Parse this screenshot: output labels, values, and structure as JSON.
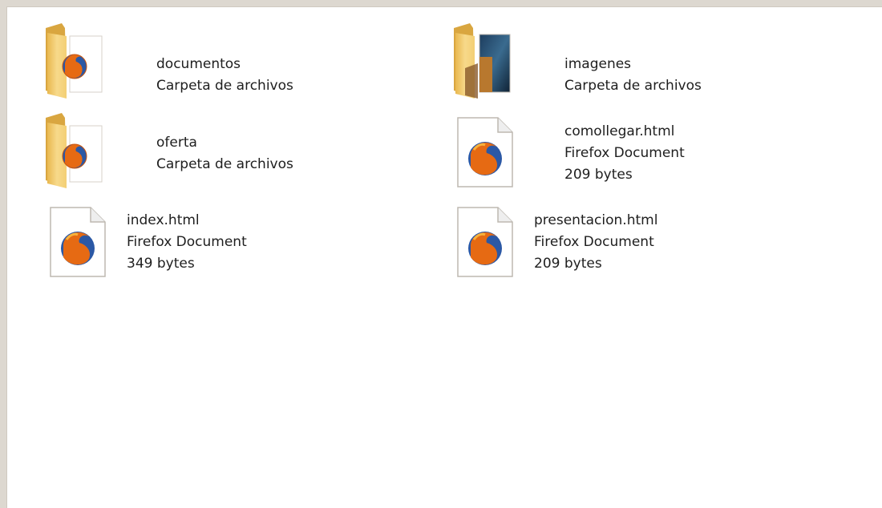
{
  "window": {
    "items": [
      {
        "name": "documentos",
        "type": "Carpeta de archivos",
        "size": "",
        "icon": "firefox-folder-icon"
      },
      {
        "name": "imagenes",
        "type": "Carpeta de archivos",
        "size": "",
        "icon": "photo-folder-icon"
      },
      {
        "name": "oferta",
        "type": "Carpeta de archivos",
        "size": "",
        "icon": "firefox-folder-icon"
      },
      {
        "name": "comollegar.html",
        "type": "Firefox Document",
        "size": "209 bytes",
        "icon": "firefox-document-icon"
      },
      {
        "name": "index.html",
        "type": "Firefox Document",
        "size": "349 bytes",
        "icon": "firefox-document-icon"
      },
      {
        "name": "presentacion.html",
        "type": "Firefox Document",
        "size": "209 bytes",
        "icon": "firefox-document-icon"
      }
    ]
  },
  "colors": {
    "background": "#ffffff",
    "frame": "#ddd8d0",
    "folder": "#f1cd6e",
    "firefox_orange": "#e66a13",
    "firefox_blue": "#2b58a5"
  }
}
